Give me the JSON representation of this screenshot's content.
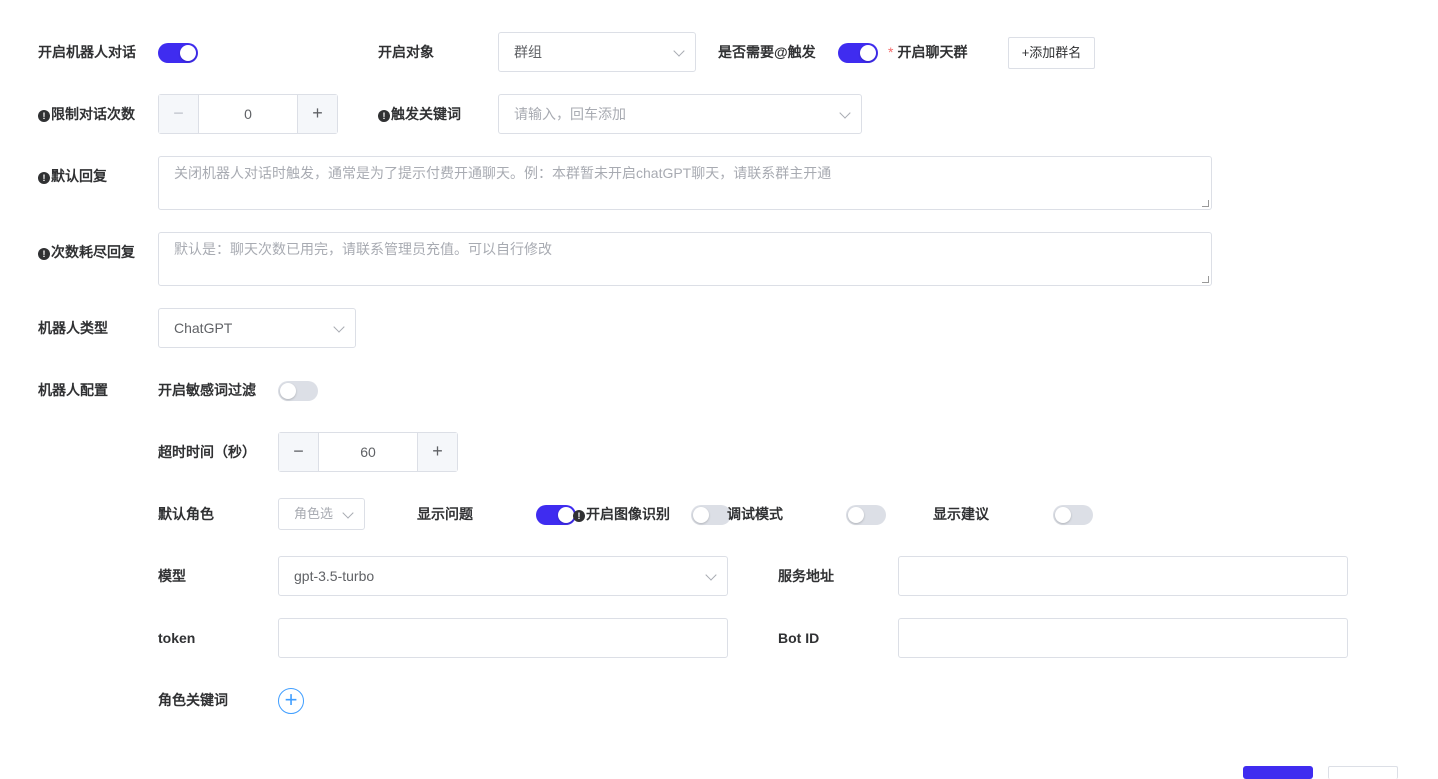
{
  "row1": {
    "enable_bot_label": "开启机器人对话",
    "enable_bot_on": true,
    "target_label": "开启对象",
    "target_value": "群组",
    "need_at_label": "是否需要@触发",
    "need_at_on": true,
    "chat_group_required": "*",
    "chat_group_label": "开启聊天群",
    "add_group_button": "+添加群名"
  },
  "row2": {
    "limit_icon": "!",
    "limit_label": "限制对话次数",
    "limit_value": "0",
    "minus": "−",
    "plus": "+",
    "keyword_icon": "!",
    "keyword_label": "触发关键词",
    "keyword_placeholder": "请输入，回车添加"
  },
  "default_reply": {
    "icon": "!",
    "label": "默认回复",
    "placeholder": "关闭机器人对话时触发，通常是为了提示付费开通聊天。例：本群暂未开启chatGPT聊天，请联系群主开通"
  },
  "exhausted_reply": {
    "icon": "!",
    "label": "次数耗尽回复",
    "placeholder": "默认是：聊天次数已用完，请联系管理员充值。可以自行修改"
  },
  "bot_type": {
    "label": "机器人类型",
    "value": "ChatGPT"
  },
  "bot_config": {
    "label": "机器人配置",
    "sensitive_label": "开启敏感词过滤",
    "sensitive_on": false,
    "timeout_label": "超时时间（秒）",
    "timeout_value": "60",
    "minus": "−",
    "plus": "+",
    "role_label": "默认角色",
    "role_placeholder": "角色选",
    "show_question_label": "显示问题",
    "show_question_on": true,
    "image_icon": "!",
    "image_label": "开启图像识别",
    "image_on": false,
    "debug_label": "调试模式",
    "debug_on": false,
    "suggest_label": "显示建议",
    "suggest_on": false,
    "model_label": "模型",
    "model_value": "gpt-3.5-turbo",
    "service_label": "服务地址",
    "service_value": "",
    "token_label": "token",
    "token_value": "",
    "botid_label": "Bot ID",
    "botid_value": "",
    "role_keyword_label": "角色关键词",
    "add_symbol": "+"
  },
  "colors": {
    "accent": "#3f2cf0",
    "switch_off": "#dcdfe6",
    "add_icon": "#409eff"
  }
}
